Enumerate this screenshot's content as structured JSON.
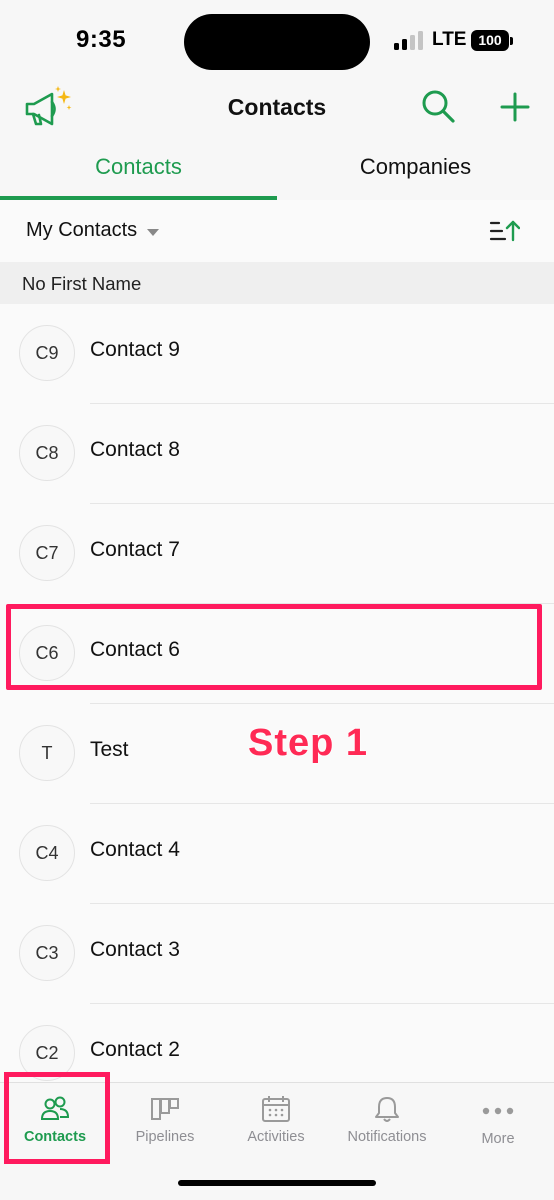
{
  "status_bar": {
    "time": "9:35",
    "network": "LTE",
    "battery": "100"
  },
  "header": {
    "title": "Contacts",
    "icons": {
      "left": "megaphone-sparkle-icon",
      "search": "search-icon",
      "add": "plus-icon"
    }
  },
  "tabs": [
    {
      "label": "Contacts",
      "active": true
    },
    {
      "label": "Companies",
      "active": false
    }
  ],
  "filter": {
    "selected": "My Contacts",
    "sort_icon": "sort-ascending-icon"
  },
  "section_header": "No First Name",
  "contacts": [
    {
      "initials": "C9",
      "name": "Contact 9"
    },
    {
      "initials": "C8",
      "name": "Contact 8"
    },
    {
      "initials": "C7",
      "name": "Contact 7"
    },
    {
      "initials": "C6",
      "name": "Contact 6"
    },
    {
      "initials": "T",
      "name": "Test"
    },
    {
      "initials": "C4",
      "name": "Contact 4"
    },
    {
      "initials": "C3",
      "name": "Contact 3"
    },
    {
      "initials": "C2",
      "name": "Contact 2"
    }
  ],
  "annotation": {
    "step_label": "Step 1"
  },
  "bottom_nav": [
    {
      "label": "Contacts",
      "icon": "contacts-icon",
      "active": true
    },
    {
      "label": "Pipelines",
      "icon": "pipelines-icon",
      "active": false
    },
    {
      "label": "Activities",
      "icon": "calendar-icon",
      "active": false
    },
    {
      "label": "Notifications",
      "icon": "bell-icon",
      "active": false
    },
    {
      "label": "More",
      "icon": "more-dots-icon",
      "active": false
    }
  ],
  "colors": {
    "accent": "#1e9b4f",
    "annotation": "#ff1a5e",
    "inactive_nav": "#8e8e93"
  }
}
